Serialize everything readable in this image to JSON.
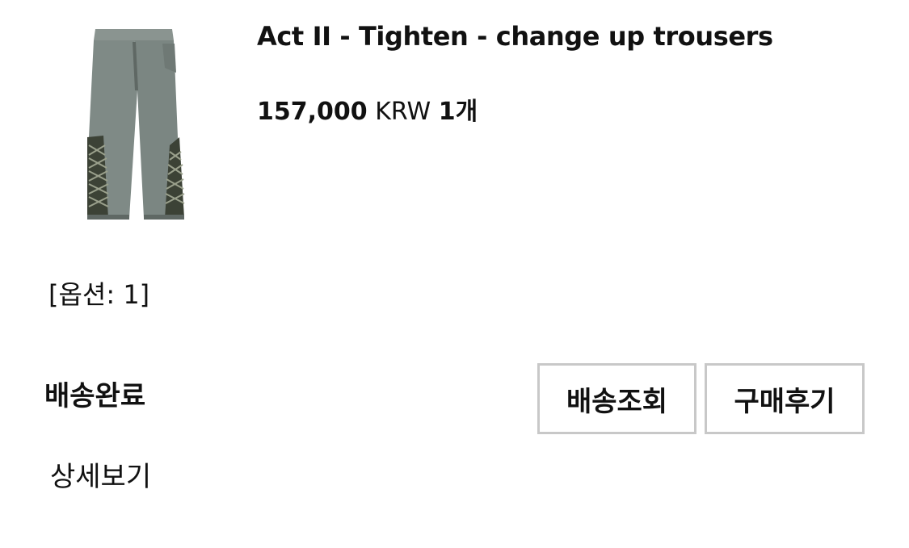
{
  "product": {
    "title": "Act II - Tighten - change up trousers",
    "price_amount": "157,000",
    "currency": "KRW",
    "quantity": "1개",
    "image_icon": "trousers-thumbnail"
  },
  "option": {
    "text": "[옵션: 1]"
  },
  "order": {
    "status": "배송완료",
    "track_button": "배송조회",
    "review_button": "구매후기",
    "details_link": "상세보기"
  },
  "colors": {
    "trouser_gray": "#7f8a86",
    "trouser_shadow": "#5f6864",
    "lace_dark": "#3c4236",
    "button_border": "#c8c8c8"
  }
}
